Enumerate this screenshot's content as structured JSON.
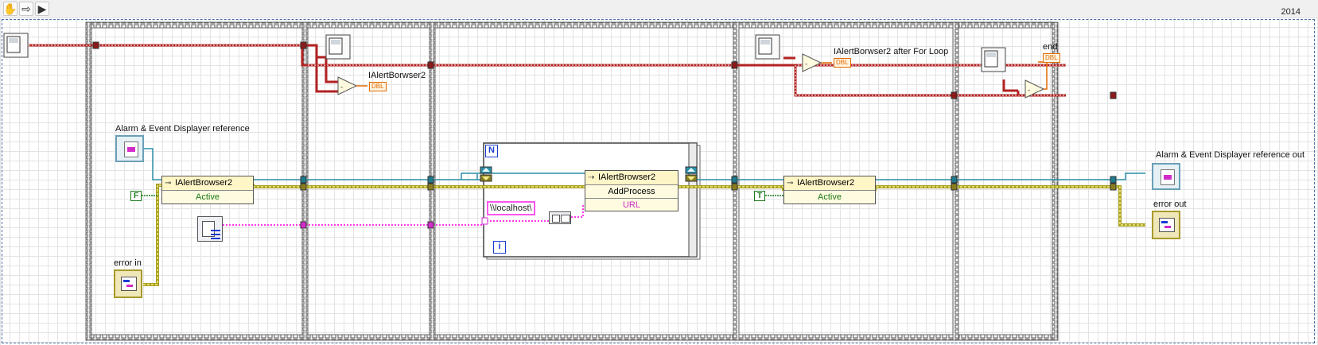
{
  "toolbar": {
    "tools": [
      {
        "icon": "hand-tool-icon"
      },
      {
        "icon": "arrow-tool-icon"
      },
      {
        "icon": "run-icon"
      }
    ],
    "year": "2014"
  },
  "labels": {
    "ref_in": "Alarm & Event Displayer reference",
    "ref_out": "Alarm & Event Displayer reference out",
    "error_in": "error in",
    "error_out": "error out",
    "ialert_1": "IAlertBorwser2",
    "ialert_after": "IAlertBorwser2 after For Loop",
    "end": "end"
  },
  "constants": {
    "false": "F",
    "true": "T",
    "localhost": "\\\\localhost\\",
    "dbl": "DBL",
    "loop_count": "N",
    "loop_index": "i"
  },
  "nodes": {
    "prop1": {
      "header": "IAlertBrowser2",
      "row": "Active"
    },
    "invoke": {
      "header": "IAlertBrowser2",
      "method": "AddProcess",
      "param": "URL"
    },
    "prop2": {
      "header": "IAlertBrowser2",
      "row": "Active"
    }
  },
  "colors": {
    "error_wire": "#a8a021",
    "refnum_wire": "#2b8fa8",
    "string_wire": "#ff38e8",
    "timer_wire": "#b22222",
    "dbl_orange": "#e06b00",
    "bool_green": "#1b7a1b",
    "loop_blue": "#1a3bd1"
  }
}
